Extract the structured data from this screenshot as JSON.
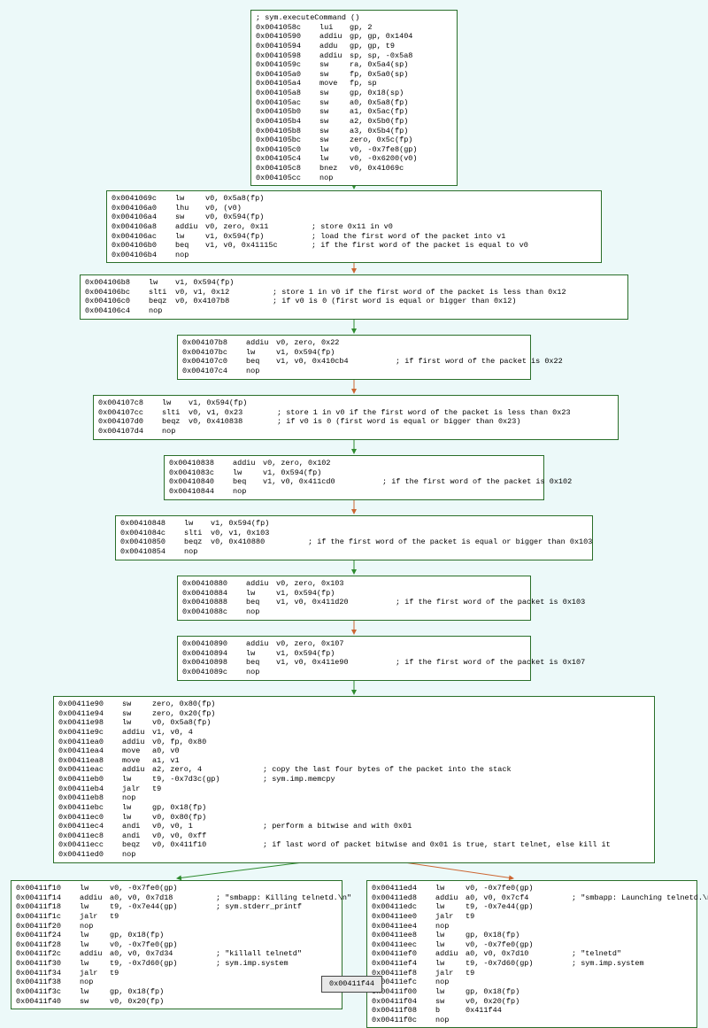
{
  "final": {
    "addr": "0x00411f44"
  },
  "blocks": {
    "n0": [
      {
        "a": "",
        "m": "",
        "r": "; sym.executeCommand ()"
      },
      {
        "a": "0x0041058c",
        "m": "lui",
        "r": "gp, 2"
      },
      {
        "a": "0x00410590",
        "m": "addiu",
        "r": "gp, gp, 0x1404"
      },
      {
        "a": "0x00410594",
        "m": "addu",
        "r": "gp, gp, t9"
      },
      {
        "a": "0x00410598",
        "m": "addiu",
        "r": "sp, sp, -0x5a8"
      },
      {
        "a": "0x0041059c",
        "m": "sw",
        "r": "ra, 0x5a4(sp)"
      },
      {
        "a": "0x004105a0",
        "m": "sw",
        "r": "fp, 0x5a0(sp)"
      },
      {
        "a": "0x004105a4",
        "m": "move",
        "r": "fp, sp"
      },
      {
        "a": "0x004105a8",
        "m": "sw",
        "r": "gp, 0x18(sp)"
      },
      {
        "a": "0x004105ac",
        "m": "sw",
        "r": "a0, 0x5a8(fp)"
      },
      {
        "a": "0x004105b0",
        "m": "sw",
        "r": "a1, 0x5ac(fp)"
      },
      {
        "a": "0x004105b4",
        "m": "sw",
        "r": "a2, 0x5b0(fp)"
      },
      {
        "a": "0x004105b8",
        "m": "sw",
        "r": "a3, 0x5b4(fp)"
      },
      {
        "a": "0x004105bc",
        "m": "sw",
        "r": "zero, 0x5c(fp)"
      },
      {
        "a": "0x004105c0",
        "m": "lw",
        "r": "v0, -0x7fe8(gp)"
      },
      {
        "a": "0x004105c4",
        "m": "lw",
        "r": "v0, -0x6200(v0)"
      },
      {
        "a": "0x004105c8",
        "m": "bnez",
        "r": "v0, 0x41069c"
      },
      {
        "a": "0x004105cc",
        "m": "nop",
        "r": ""
      }
    ],
    "n1": [
      {
        "a": "0x0041069c",
        "m": "lw",
        "r": "v0, 0x5a8(fp)"
      },
      {
        "a": "0x004106a0",
        "m": "lhu",
        "r": "v0, (v0)"
      },
      {
        "a": "0x004106a4",
        "m": "sw",
        "r": "v0, 0x594(fp)"
      },
      {
        "a": "0x004106a8",
        "m": "addiu",
        "r": "v0, zero, 0x11",
        "c": "; store 0x11 in v0"
      },
      {
        "a": "0x004106ac",
        "m": "lw",
        "r": "v1, 0x594(fp)",
        "c": "; load the first word of the packet into v1"
      },
      {
        "a": "0x004106b0",
        "m": "beq",
        "r": "v1, v0, 0x41115c",
        "c": "; if the first word of the packet is equal to v0"
      },
      {
        "a": "0x004106b4",
        "m": "nop",
        "r": ""
      }
    ],
    "n2": [
      {
        "a": "0x004106b8",
        "m": "lw",
        "r": "v1, 0x594(fp)"
      },
      {
        "a": "0x004106bc",
        "m": "slti",
        "r": "v0, v1, 0x12",
        "c": "; store 1 in v0 if the first word of the packet is less than 0x12"
      },
      {
        "a": "0x004106c0",
        "m": "beqz",
        "r": "v0, 0x4107b8",
        "c": "; if v0 is 0 (first word is equal or bigger than 0x12)"
      },
      {
        "a": "0x004106c4",
        "m": "nop",
        "r": ""
      }
    ],
    "n3": [
      {
        "a": "0x004107b8",
        "m": "addiu",
        "r": "v0, zero, 0x22"
      },
      {
        "a": "0x004107bc",
        "m": "lw",
        "r": "v1, 0x594(fp)"
      },
      {
        "a": "0x004107c0",
        "m": "beq",
        "r": "v1, v0, 0x410cb4",
        "c": "; if first word of the packet is 0x22"
      },
      {
        "a": "0x004107c4",
        "m": "nop",
        "r": ""
      }
    ],
    "n4": [
      {
        "a": "0x004107c8",
        "m": "lw",
        "r": "v1, 0x594(fp)"
      },
      {
        "a": "0x004107cc",
        "m": "slti",
        "r": "v0, v1, 0x23",
        "c": "; store 1 in v0 if the first word of the packet is less than 0x23"
      },
      {
        "a": "0x004107d0",
        "m": "beqz",
        "r": "v0, 0x410838",
        "c": "; if v0 is 0 (first word is equal or bigger than 0x23)"
      },
      {
        "a": "0x004107d4",
        "m": "nop",
        "r": ""
      }
    ],
    "n5": [
      {
        "a": "0x00410838",
        "m": "addiu",
        "r": "v0, zero, 0x102"
      },
      {
        "a": "0x0041083c",
        "m": "lw",
        "r": "v1, 0x594(fp)"
      },
      {
        "a": "0x00410840",
        "m": "beq",
        "r": "v1, v0, 0x411cd0",
        "c": "; if the first word of the packet is 0x102"
      },
      {
        "a": "0x00410844",
        "m": "nop",
        "r": ""
      }
    ],
    "n6": [
      {
        "a": "0x00410848",
        "m": "lw",
        "r": "v1, 0x594(fp)"
      },
      {
        "a": "0x0041084c",
        "m": "slti",
        "r": "v0, v1, 0x103"
      },
      {
        "a": "0x00410850",
        "m": "beqz",
        "r": "v0, 0x410880",
        "c": "; if the first word of the packet is equal or bigger than 0x103"
      },
      {
        "a": "0x00410854",
        "m": "nop",
        "r": ""
      }
    ],
    "n7": [
      {
        "a": "0x00410880",
        "m": "addiu",
        "r": "v0, zero, 0x103"
      },
      {
        "a": "0x00410884",
        "m": "lw",
        "r": "v1, 0x594(fp)"
      },
      {
        "a": "0x00410888",
        "m": "beq",
        "r": "v1, v0, 0x411d20",
        "c": "; if the first word of the packet is 0x103"
      },
      {
        "a": "0x0041088c",
        "m": "nop",
        "r": ""
      }
    ],
    "n8": [
      {
        "a": "0x00410890",
        "m": "addiu",
        "r": "v0, zero, 0x107"
      },
      {
        "a": "0x00410894",
        "m": "lw",
        "r": "v1, 0x594(fp)"
      },
      {
        "a": "0x00410898",
        "m": "beq",
        "r": "v1, v0, 0x411e90",
        "c": "; if the first word of the packet is 0x107"
      },
      {
        "a": "0x0041089c",
        "m": "nop",
        "r": ""
      }
    ],
    "n9": [
      {
        "a": "0x00411e90",
        "m": "sw",
        "r": "zero, 0x80(fp)"
      },
      {
        "a": "0x00411e94",
        "m": "sw",
        "r": "zero, 0x20(fp)"
      },
      {
        "a": "0x00411e98",
        "m": "lw",
        "r": "v0, 0x5a8(fp)"
      },
      {
        "a": "0x00411e9c",
        "m": "addiu",
        "r": "v1, v0, 4"
      },
      {
        "a": "0x00411ea0",
        "m": "addiu",
        "r": "v0, fp, 0x80"
      },
      {
        "a": "0x00411ea4",
        "m": "move",
        "r": "a0, v0"
      },
      {
        "a": "0x00411ea8",
        "m": "move",
        "r": "a1, v1"
      },
      {
        "a": "0x00411eac",
        "m": "addiu",
        "r": "a2, zero, 4",
        "c": "; copy the last four bytes of the packet into the stack"
      },
      {
        "a": "0x00411eb0",
        "m": "lw",
        "r": "t9, -0x7d3c(gp)",
        "c": "; sym.imp.memcpy"
      },
      {
        "a": "0x00411eb4",
        "m": "jalr",
        "r": "t9"
      },
      {
        "a": "0x00411eb8",
        "m": "nop",
        "r": ""
      },
      {
        "a": "0x00411ebc",
        "m": "lw",
        "r": "gp, 0x18(fp)"
      },
      {
        "a": "0x00411ec0",
        "m": "lw",
        "r": "v0, 0x80(fp)"
      },
      {
        "a": "0x00411ec4",
        "m": "andi",
        "r": "v0, v0, 1",
        "c": "; perform a bitwise and with 0x01"
      },
      {
        "a": "0x00411ec8",
        "m": "andi",
        "r": "v0, v0, 0xff"
      },
      {
        "a": "0x00411ecc",
        "m": "beqz",
        "r": "v0, 0x411f10",
        "c": "; if last word of packet bitwise and 0x01 is true, start telnet, else kill it"
      },
      {
        "a": "0x00411ed0",
        "m": "nop",
        "r": ""
      }
    ],
    "n10": [
      {
        "a": "0x00411f10",
        "m": "lw",
        "r": "v0, -0x7fe0(gp)"
      },
      {
        "a": "0x00411f14",
        "m": "addiu",
        "r": "a0, v0, 0x7d18",
        "c": "; \"smbapp: Killing telnetd.\\n\""
      },
      {
        "a": "0x00411f18",
        "m": "lw",
        "r": "t9, -0x7e44(gp)",
        "c": "; sym.stderr_printf"
      },
      {
        "a": "0x00411f1c",
        "m": "jalr",
        "r": "t9"
      },
      {
        "a": "0x00411f20",
        "m": "nop",
        "r": ""
      },
      {
        "a": "0x00411f24",
        "m": "lw",
        "r": "gp, 0x18(fp)"
      },
      {
        "a": "0x00411f28",
        "m": "lw",
        "r": "v0, -0x7fe0(gp)"
      },
      {
        "a": "0x00411f2c",
        "m": "addiu",
        "r": "a0, v0, 0x7d34",
        "c": "; \"killall telnetd\""
      },
      {
        "a": "0x00411f30",
        "m": "lw",
        "r": "t9, -0x7d60(gp)",
        "c": "; sym.imp.system"
      },
      {
        "a": "0x00411f34",
        "m": "jalr",
        "r": "t9"
      },
      {
        "a": "0x00411f38",
        "m": "nop",
        "r": ""
      },
      {
        "a": "0x00411f3c",
        "m": "lw",
        "r": "gp, 0x18(fp)"
      },
      {
        "a": "0x00411f40",
        "m": "sw",
        "r": "v0, 0x20(fp)"
      }
    ],
    "n11": [
      {
        "a": "0x00411ed4",
        "m": "lw",
        "r": "v0, -0x7fe0(gp)"
      },
      {
        "a": "0x00411ed8",
        "m": "addiu",
        "r": "a0, v0, 0x7cf4",
        "c": "; \"smbapp: Launching telnetd.\\n\""
      },
      {
        "a": "0x00411edc",
        "m": "lw",
        "r": "t9, -0x7e44(gp)"
      },
      {
        "a": "0x00411ee0",
        "m": "jalr",
        "r": "t9"
      },
      {
        "a": "0x00411ee4",
        "m": "nop",
        "r": ""
      },
      {
        "a": "0x00411ee8",
        "m": "lw",
        "r": "gp, 0x18(fp)"
      },
      {
        "a": "0x00411eec",
        "m": "lw",
        "r": "v0, -0x7fe0(gp)"
      },
      {
        "a": "0x00411ef0",
        "m": "addiu",
        "r": "a0, v0, 0x7d10",
        "c": "; \"telnetd\""
      },
      {
        "a": "0x00411ef4",
        "m": "lw",
        "r": "t9, -0x7d60(gp)",
        "c": "; sym.imp.system"
      },
      {
        "a": "0x00411ef8",
        "m": "jalr",
        "r": "t9"
      },
      {
        "a": "0x00411efc",
        "m": "nop",
        "r": ""
      },
      {
        "a": "0x00411f00",
        "m": "lw",
        "r": "gp, 0x18(fp)"
      },
      {
        "a": "0x00411f04",
        "m": "sw",
        "r": "v0, 0x20(fp)"
      },
      {
        "a": "0x00411f08",
        "m": "b",
        "r": "0x411f44"
      },
      {
        "a": "0x00411f0c",
        "m": "nop",
        "r": ""
      }
    ]
  },
  "layout": {
    "addrW": {
      "n0": 58,
      "n1": 58,
      "n2": 58,
      "n3": 58,
      "n4": 58,
      "n5": 58,
      "n6": 58,
      "n7": 58,
      "n8": 58,
      "n9": 58,
      "n10": 58,
      "n11": 58
    },
    "mnW": {
      "n0": 34,
      "n1": 34,
      "n2": 30,
      "n3": 34,
      "n4": 30,
      "n5": 34,
      "n6": 30,
      "n7": 34,
      "n8": 34,
      "n9": 34,
      "n10": 34,
      "n11": 34
    },
    "argW": {
      "n0": 0,
      "n1": 120,
      "n2": 110,
      "n3": 135,
      "n4": 100,
      "n5": 135,
      "n6": 110,
      "n7": 135,
      "n8": 135,
      "n9": 125,
      "n10": 120,
      "n11": 120
    }
  }
}
